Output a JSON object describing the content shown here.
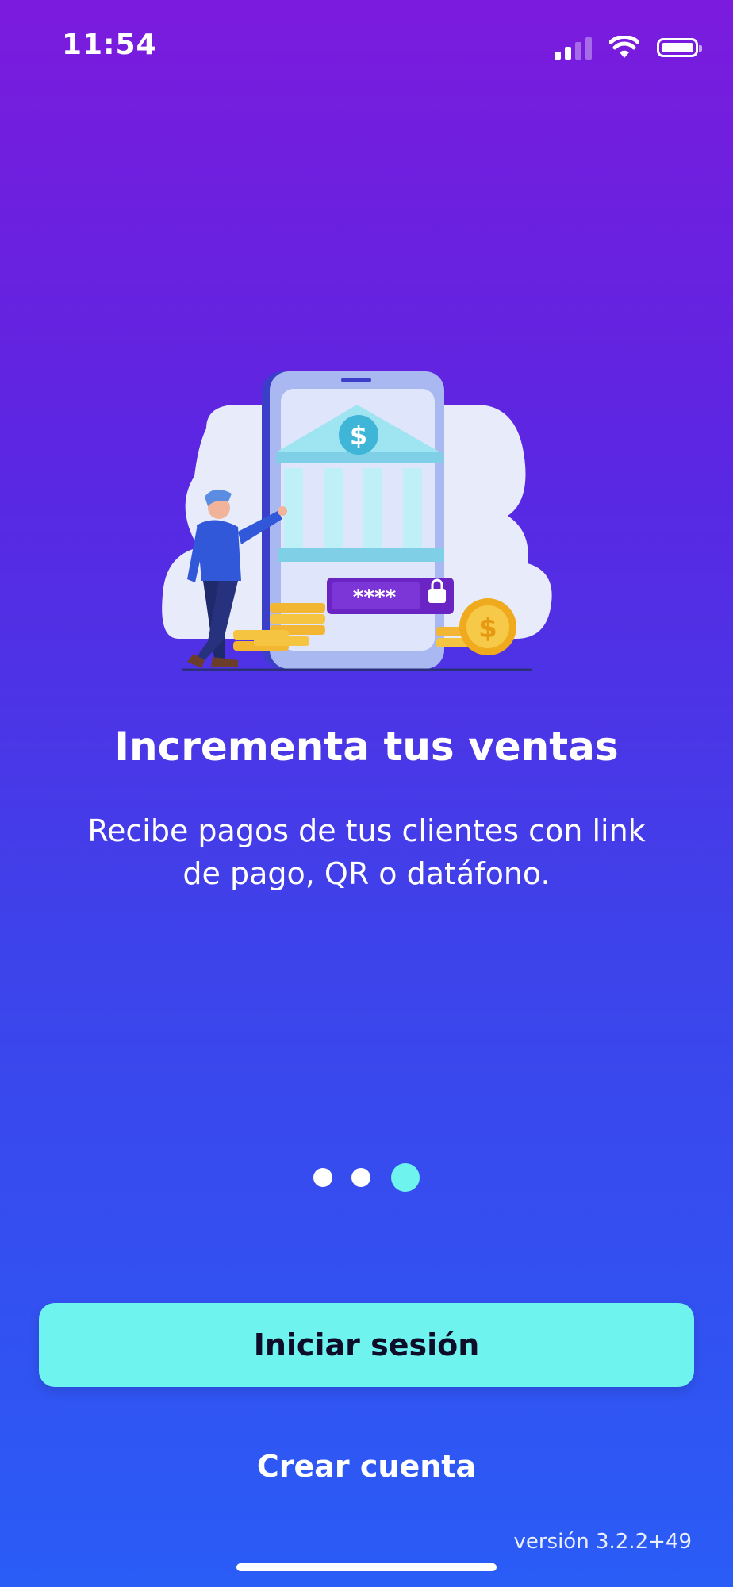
{
  "status_bar": {
    "time": "11:54",
    "icons": [
      "cellular-signal-icon",
      "wifi-icon",
      "battery-icon"
    ]
  },
  "illustration": {
    "icon": "bank-payment-illustration",
    "password_mask": "****"
  },
  "onboarding": {
    "title": "Incrementa tus ventas",
    "subtitle": "Recibe pagos de tus clientes con link de pago, QR o datáfono.",
    "page_count": 3,
    "current_page": 3
  },
  "actions": {
    "login_label": "Iniciar sesión",
    "signup_label": "Crear cuenta"
  },
  "footer": {
    "version": "versión 3.2.2+49"
  },
  "colors": {
    "accent": "#6ef3ee",
    "gradient_top": "#7b1bdd",
    "gradient_bottom": "#2a5cf6"
  }
}
